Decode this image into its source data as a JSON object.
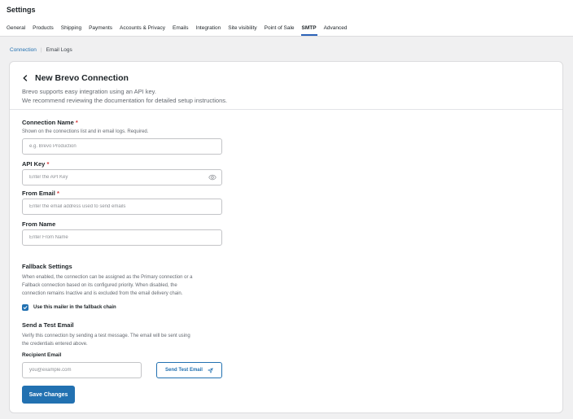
{
  "header": {
    "title": "Settings",
    "tabs": [
      {
        "label": "General"
      },
      {
        "label": "Products"
      },
      {
        "label": "Shipping"
      },
      {
        "label": "Payments"
      },
      {
        "label": "Accounts & Privacy"
      },
      {
        "label": "Emails"
      },
      {
        "label": "Integration"
      },
      {
        "label": "Site visibility"
      },
      {
        "label": "Point of Sale"
      },
      {
        "label": "SMTP",
        "active": true
      },
      {
        "label": "Advanced"
      }
    ]
  },
  "subnav": {
    "connection": "Connection",
    "separator": "|",
    "email_logs": "Email Logs"
  },
  "card": {
    "title": "New Brevo Connection",
    "desc_line1": "Brevo supports easy integration using an API key.",
    "desc_line2": "We recommend reviewing the documentation for detailed setup instructions."
  },
  "form": {
    "connection_name": {
      "label": "Connection Name",
      "required": "*",
      "hint": "Shown on the connections list and in email logs. Required.",
      "placeholder": "e.g. Brevo Production"
    },
    "api_key": {
      "label": "API Key",
      "required": "*",
      "placeholder": "Enter the API Key"
    },
    "from_email": {
      "label": "From Email",
      "required": "*",
      "placeholder": "Enter the email address used to send emails"
    },
    "from_name": {
      "label": "From Name",
      "placeholder": "Enter From Name"
    }
  },
  "fallback": {
    "title": "Fallback Settings",
    "line1": "When enabled, the connection can be assigned as the Primary connection or a",
    "line2": "Fallback connection based on its configured priority. When disabled, the",
    "line3": "connection remains Inactive and is excluded from the email delivery chain.",
    "checkbox_label": "Use this mailer in the fallback chain",
    "checked": true
  },
  "test": {
    "title": "Send a Test Email",
    "line1": "Verify this connection by sending a test message. The email will be sent using",
    "line2": "the credentials entered above.",
    "recipient_label": "Recipient Email",
    "recipient_placeholder": "you@example.com",
    "button_label": "Send Test Email"
  },
  "save_label": "Save Changes",
  "colors": {
    "accent": "#2271b1",
    "tab_underline": "#2c63b8",
    "required": "#d63638"
  },
  "icons": {
    "back": "chevron-left-icon",
    "eye": "eye-icon",
    "send": "paper-plane-icon",
    "check": "check-icon"
  }
}
